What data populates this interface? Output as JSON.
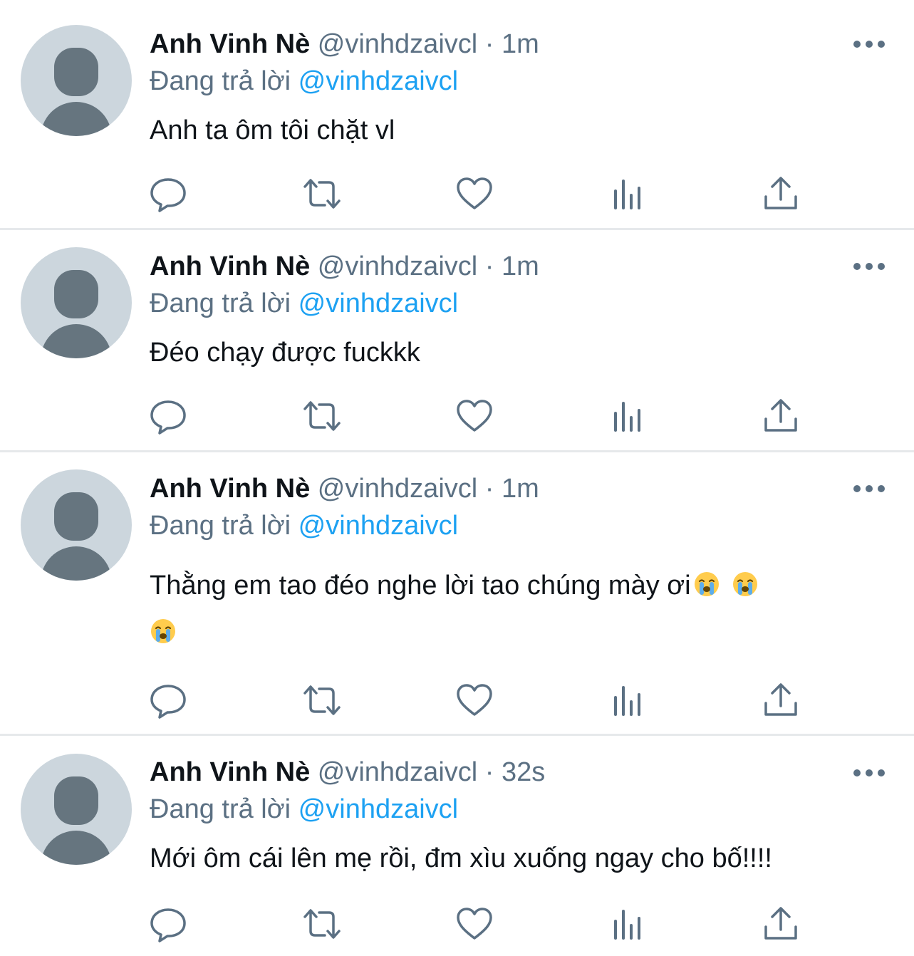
{
  "tweets": [
    {
      "author_name": "Anh Vinh Nè",
      "handle": "@vinhdzaivcl",
      "separator": "·",
      "time": "1m",
      "replying_label": "Đang trả lời",
      "replying_to": "@vinhdzaivcl",
      "text": "Anh ta ôm tôi chặt vl"
    },
    {
      "author_name": "Anh Vinh Nè",
      "handle": "@vinhdzaivcl",
      "separator": "·",
      "time": "1m",
      "replying_label": "Đang trả lời",
      "replying_to": "@vinhdzaivcl",
      "text": "Đéo chạy được fuckkk"
    },
    {
      "author_name": "Anh Vinh Nè",
      "handle": "@vinhdzaivcl",
      "separator": "·",
      "time": "1m",
      "replying_label": "Đang trả lời",
      "replying_to": "@vinhdzaivcl",
      "text": "Thằng em tao đéo nghe lời tao chúng mày ơi"
    },
    {
      "author_name": "Anh Vinh Nè",
      "handle": "@vinhdzaivcl",
      "separator": "·",
      "time": "32s",
      "replying_label": "Đang trả lời",
      "replying_to": "@vinhdzaivcl",
      "text": "Mới ôm cái lên mẹ rồi, đm xìu xuống ngay cho bố!!!!"
    }
  ],
  "tweet_3_emojis": [
    "loudly-crying-face",
    "loudly-crying-face",
    "loudly-crying-face"
  ],
  "icons": {
    "more": "more-icon",
    "reply": "reply-icon",
    "retweet": "retweet-icon",
    "like": "like-icon",
    "analytics": "analytics-icon",
    "share": "share-icon"
  },
  "colors": {
    "text_primary": "#0f1419",
    "text_secondary": "#5b7083",
    "link": "#1da1f2",
    "avatar_bg": "#ccd6dd",
    "avatar_fg": "#66757f",
    "divider": "#e6e9eb",
    "icon": "#5b7083"
  }
}
